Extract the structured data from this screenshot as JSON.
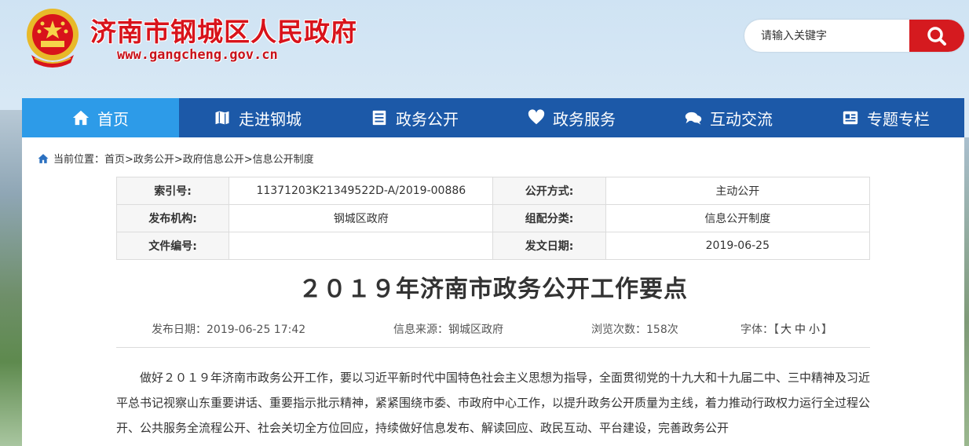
{
  "header": {
    "site_title": "济南市钢城区人民政府",
    "site_url": "www.gangcheng.gov.cn",
    "emblem_icon": "national-emblem-icon",
    "search": {
      "placeholder": "请输入关键字",
      "button_icon": "search-icon"
    }
  },
  "colors": {
    "brand_red": "#d51a1f",
    "nav_blue": "#1c59a8",
    "nav_active": "#2d9be8"
  },
  "nav": {
    "items": [
      {
        "label": "首页",
        "icon": "home-icon",
        "active": true
      },
      {
        "label": "走进钢城",
        "icon": "map-icon"
      },
      {
        "label": "政务公开",
        "icon": "list-icon"
      },
      {
        "label": "政务服务",
        "icon": "heart-icon"
      },
      {
        "label": "互动交流",
        "icon": "chat-icon"
      },
      {
        "label": "专题专栏",
        "icon": "newspaper-icon"
      }
    ]
  },
  "breadcrumb": {
    "icon": "home-icon",
    "text": "当前位置：首页>政务公开>政府信息公开>信息公开制度"
  },
  "meta_table": {
    "rows": [
      {
        "label1": "索引号:",
        "value1": "11371203K21349522D-A/2019-00886",
        "label2": "公开方式:",
        "value2": "主动公开"
      },
      {
        "label1": "发布机构:",
        "value1": "钢城区政府",
        "label2": "组配分类:",
        "value2": "信息公开制度"
      },
      {
        "label1": "文件编号:",
        "value1": "",
        "label2": "发文日期:",
        "value2": "2019-06-25"
      }
    ]
  },
  "article": {
    "title": "２０１９年济南市政务公开工作要点",
    "publish_date": "发布日期：2019-06-25 17:42",
    "source": "信息来源：钢城区政府",
    "views": "浏览次数：158次",
    "font_label": "字体：",
    "font_open": "【",
    "font_large": "大",
    "font_medium": "中",
    "font_small": "小",
    "font_close": "】",
    "body": "做好２０１９年济南市政务公开工作，要以习近平新时代中国特色社会主义思想为指导，全面贯彻党的十九大和十九届二中、三中精神及习近平总书记视察山东重要讲话、重要指示批示精神，紧紧围绕市委、市政府中心工作，以提升政务公开质量为主线，着力推动行政权力运行全过程公开、公共服务全流程公开、社会关切全方位回应，持续做好信息发布、解读回应、政民互动、平台建设，完善政务公开"
  }
}
